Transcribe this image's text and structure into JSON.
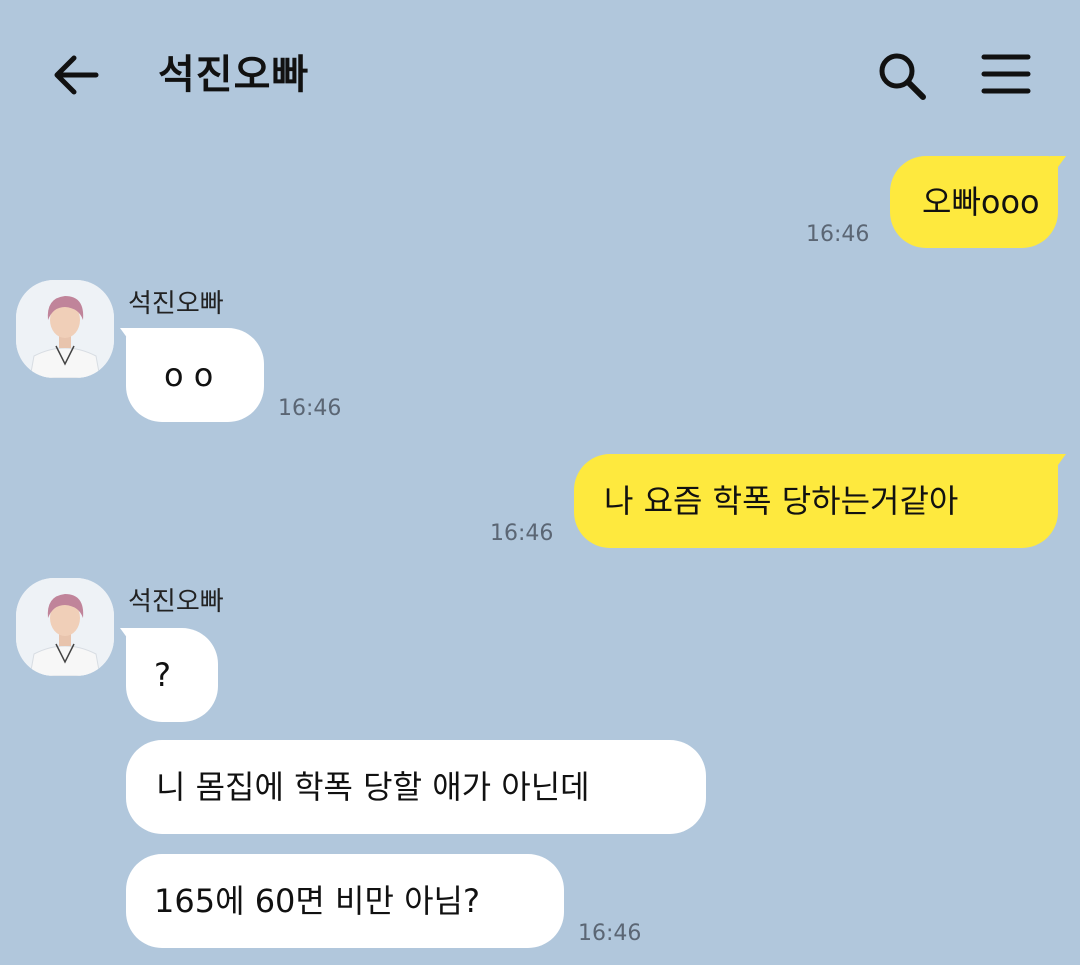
{
  "header": {
    "title": "석진오빠",
    "back_icon": "arrow-left-icon",
    "search_icon": "search-icon",
    "menu_icon": "hamburger-menu-icon"
  },
  "colors": {
    "background": "#b1c7dc",
    "sent_bubble": "#fee93e",
    "received_bubble": "#ffffff",
    "timestamp": "#5b6674"
  },
  "messages": [
    {
      "direction": "sent",
      "text": "오빠ooo",
      "time": "16:46"
    },
    {
      "direction": "received",
      "sender": "석진오빠",
      "text": "o   o",
      "time": "16:46"
    },
    {
      "direction": "sent",
      "text": "나 요즘 학폭 당하는거같아",
      "time": "16:46"
    },
    {
      "direction": "received",
      "sender": "석진오빠",
      "text": "?"
    },
    {
      "direction": "received",
      "text": "니 몸집에 학폭 당할 애가 아닌데"
    },
    {
      "direction": "received",
      "text": "165에 60면 비만 아님?",
      "time": "16:46"
    }
  ]
}
